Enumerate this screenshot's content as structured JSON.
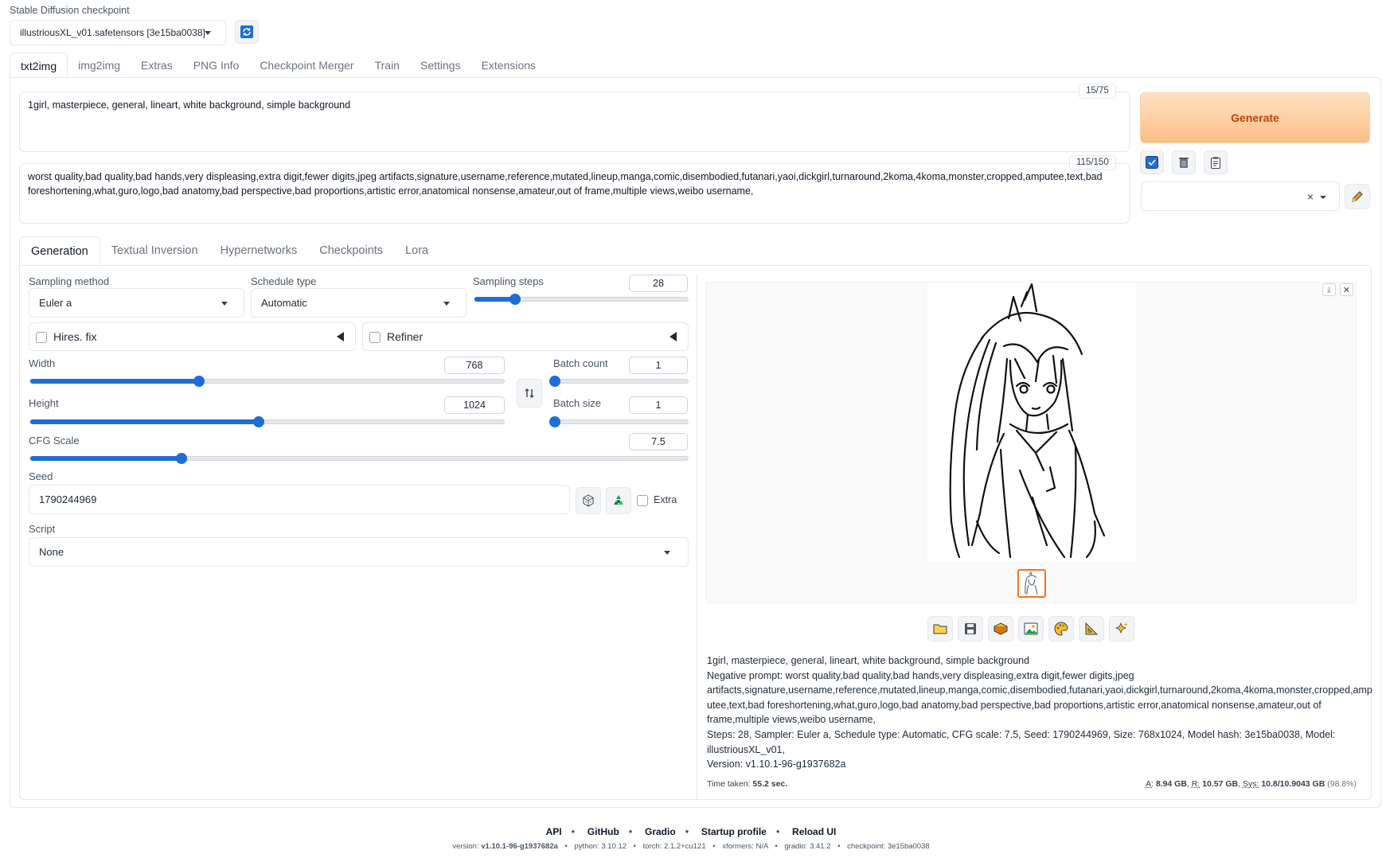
{
  "checkpoint": {
    "label": "Stable Diffusion checkpoint",
    "value": "illustriousXL_v01.safetensors [3e15ba0038]"
  },
  "main_tabs": [
    "txt2img",
    "img2img",
    "Extras",
    "PNG Info",
    "Checkpoint Merger",
    "Train",
    "Settings",
    "Extensions"
  ],
  "prompt": {
    "text": "1girl, masterpiece, general, lineart, white background, simple background",
    "token_count": "15/75"
  },
  "negative_prompt": {
    "text": "worst quality,bad quality,bad hands,very displeasing,extra digit,fewer digits,jpeg artifacts,signature,username,reference,mutated,lineup,manga,comic,disembodied,futanari,yaoi,dickgirl,turnaround,2koma,4koma,monster,cropped,amputee,text,bad foreshortening,what,guro,logo,bad anatomy,bad perspective,bad proportions,artistic error,anatomical nonsense,amateur,out of frame,multiple views,weibo username,",
    "token_count": "115/150"
  },
  "generate_label": "Generate",
  "sub_tabs": [
    "Generation",
    "Textual Inversion",
    "Hypernetworks",
    "Checkpoints",
    "Lora"
  ],
  "params": {
    "sampling_method": {
      "label": "Sampling method",
      "value": "Euler a"
    },
    "schedule_type": {
      "label": "Schedule type",
      "value": "Automatic"
    },
    "sampling_steps": {
      "label": "Sampling steps",
      "value": "28",
      "fraction": 0.19
    },
    "hires_fix": "Hires. fix",
    "refiner": "Refiner",
    "width": {
      "label": "Width",
      "value": "768",
      "fraction": 0.357
    },
    "height": {
      "label": "Height",
      "value": "1024",
      "fraction": 0.483
    },
    "batch_count": {
      "label": "Batch count",
      "value": "1",
      "fraction": 0.0
    },
    "batch_size": {
      "label": "Batch size",
      "value": "1",
      "fraction": 0.0
    },
    "cfg_scale": {
      "label": "CFG Scale",
      "value": "7.5",
      "fraction": 0.23
    },
    "seed": {
      "label": "Seed",
      "value": "1790244969"
    },
    "extra_label": "Extra",
    "script": {
      "label": "Script",
      "value": "None"
    }
  },
  "output": {
    "info_prompt": "1girl, masterpiece, general, lineart, white background, simple background",
    "info_negative_1": "Negative prompt: worst quality,bad quality,bad hands,very displeasing,extra digit,fewer digits,jpeg",
    "info_negative_2": "artifacts,signature,username,reference,mutated,lineup,manga,comic,disembodied,futanari,yaoi,dickgirl,turnaround,2koma,4koma,monster,cropped,amp",
    "info_negative_3": "utee,text,bad foreshortening,what,guro,logo,bad anatomy,bad perspective,bad proportions,artistic error,anatomical nonsense,amateur,out of",
    "info_negative_4": "frame,multiple views,weibo username,",
    "info_params": "Steps: 28, Sampler: Euler a, Schedule type: Automatic, CFG scale: 7.5, Seed: 1790244969, Size: 768x1024, Model hash: 3e15ba0038, Model: illustriousXL_v01,",
    "info_version": "Version: v1.10.1-96-g1937682a",
    "time_label": "Time taken:",
    "time_value": "55.2 sec.",
    "mem_a_label": "A:",
    "mem_a_value": "8.94 GB",
    "mem_r_label": "R:",
    "mem_r_value": "10.57 GB",
    "mem_sys_label": "Sys:",
    "mem_sys_value": "10.8/10.9043 GB",
    "mem_pct": "(98.8%)"
  },
  "footer": {
    "links": [
      "API",
      "GitHub",
      "Gradio",
      "Startup profile",
      "Reload UI"
    ],
    "versions": [
      {
        "label": "version:",
        "value": "v1.10.1-96-g1937682a"
      },
      {
        "label": "python:",
        "value": "3.10.12"
      },
      {
        "label": "torch:",
        "value": "2.1.2+cu121"
      },
      {
        "label": "xformers:",
        "value": "N/A"
      },
      {
        "label": "gradio:",
        "value": "3.41.2"
      },
      {
        "label": "checkpoint:",
        "value": "3e15ba0038"
      }
    ]
  },
  "colors": {
    "accent": "#1d6ed8",
    "generate_bg": "#fcd2a6",
    "generate_text": "#c2410c",
    "thumb_border": "#f97316"
  }
}
